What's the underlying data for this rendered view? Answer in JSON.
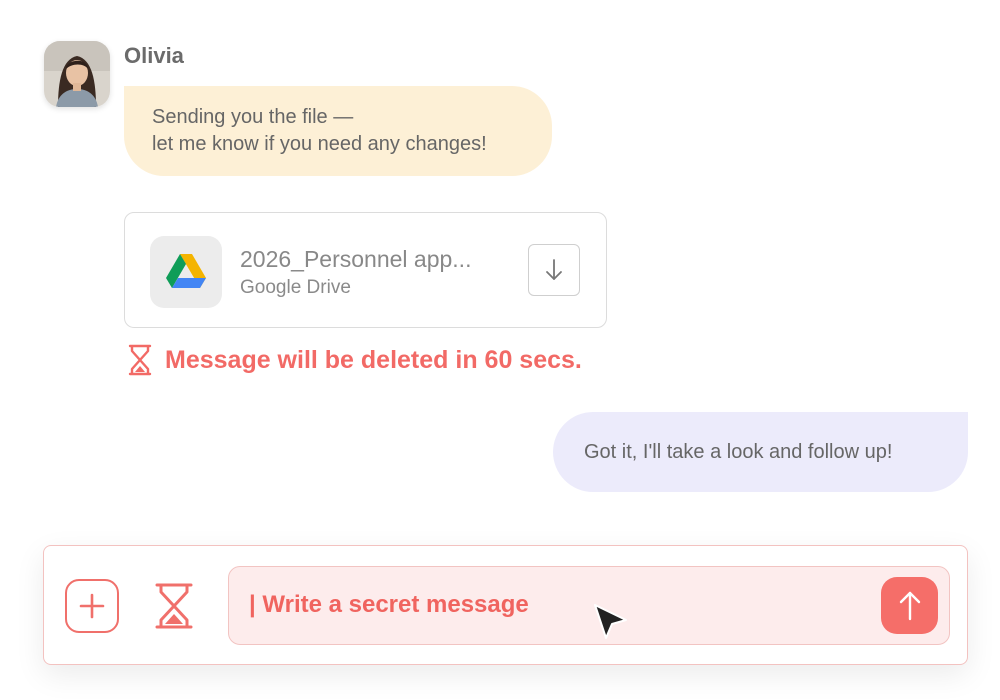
{
  "sender": {
    "name": "Olivia"
  },
  "incoming_message": {
    "lines": [
      "Sending you the file —",
      "let me know if you need any changes!"
    ]
  },
  "attachment": {
    "file_name": "2026_Personnel app...",
    "source": "Google Drive",
    "icon": "google-drive-icon",
    "download_icon": "arrow-down-icon"
  },
  "expiry_notice": {
    "text": "Message will be deleted in 60 secs.",
    "icon": "hourglass-icon"
  },
  "outgoing_message": {
    "text": "Got it, I'll take a look and follow up!"
  },
  "composer": {
    "placeholder": "| Write a secret message",
    "value": "",
    "add_icon": "plus-icon",
    "timer_icon": "hourglass-icon",
    "send_icon": "arrow-up-icon"
  },
  "colors": {
    "accent": "#f56e69",
    "incoming_bubble": "#fdf0d6",
    "outgoing_bubble": "#ecebfb",
    "composer_field": "#fdecec"
  }
}
